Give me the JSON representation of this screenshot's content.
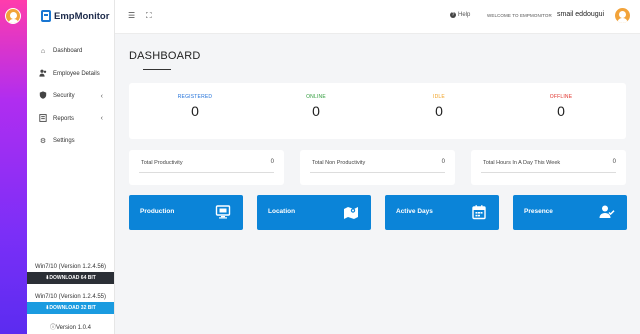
{
  "brand": {
    "name": "EmpMonitor"
  },
  "sidebar": {
    "items": [
      {
        "label": "Dashboard",
        "icon": "home-icon",
        "has_submenu": false
      },
      {
        "label": "Employee Details",
        "icon": "users-icon",
        "has_submenu": false
      },
      {
        "label": "Security",
        "icon": "shield-icon",
        "has_submenu": true
      },
      {
        "label": "Reports",
        "icon": "report-icon",
        "has_submenu": true
      },
      {
        "label": "Settings",
        "icon": "gear-icon",
        "has_submenu": false
      }
    ],
    "downloads": [
      {
        "version": "Win7/10 (Version 1.2.4.56)",
        "button": "DOWNLOAD 64 BIT"
      },
      {
        "version": "Win7/10 (Version 1.2.4.55)",
        "button": "DOWNLOAD 32 BIT"
      }
    ],
    "app_version": "Version 1.0.4"
  },
  "topbar": {
    "help_label": "Help",
    "welcome_text": "WELCOME TO EMPMONITOR",
    "user_name": "smail eddougui"
  },
  "page": {
    "title": "DASHBOARD"
  },
  "status": [
    {
      "label": "REGISTERED",
      "value": "0",
      "color": "#1e6fd9"
    },
    {
      "label": "ONLINE",
      "value": "0",
      "color": "#2e9b3a"
    },
    {
      "label": "IDLE",
      "value": "0",
      "color": "#f0a020"
    },
    {
      "label": "OFFLINE",
      "value": "0",
      "color": "#e0302a"
    }
  ],
  "productivity": [
    {
      "label": "Total Productivity",
      "value": "0"
    },
    {
      "label": "Total Non Productivity",
      "value": "0"
    },
    {
      "label": "Total Hours In A Day This Week",
      "value": "0"
    }
  ],
  "tiles": [
    {
      "label": "Production",
      "icon": "monitor-icon"
    },
    {
      "label": "Location",
      "icon": "map-icon"
    },
    {
      "label": "Active Days",
      "icon": "calendar-icon"
    },
    {
      "label": "Presence",
      "icon": "user-check-icon"
    }
  ],
  "colors": {
    "tile_blue": "#0b84d8",
    "download_blue": "#1a9be0",
    "download_dark": "#2b2f36"
  }
}
